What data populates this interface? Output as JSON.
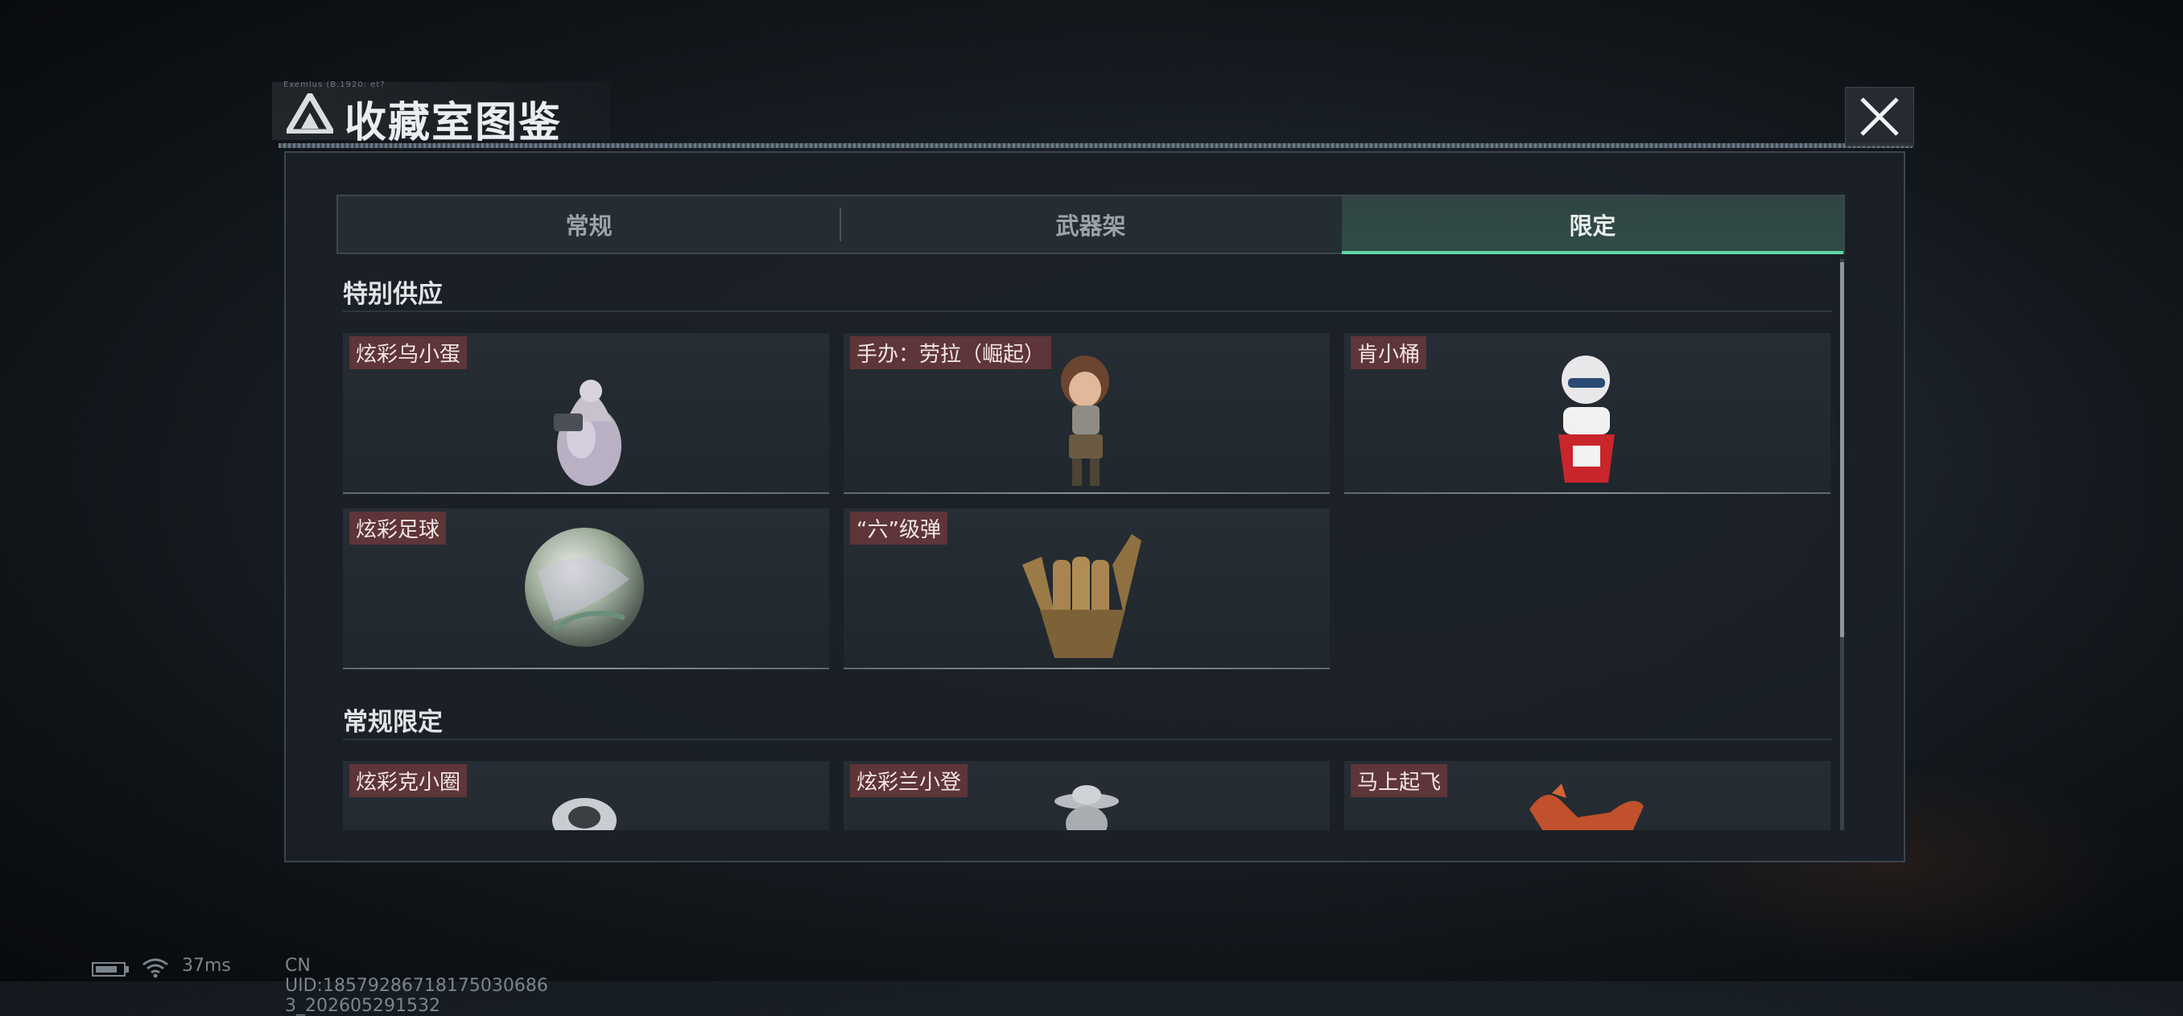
{
  "window": {
    "title": "收藏室图鉴",
    "header_small_text": "Exemlus (B.1920: et?"
  },
  "tabs": [
    {
      "label": "常规",
      "active": false
    },
    {
      "label": "武器架",
      "active": false
    },
    {
      "label": "限定",
      "active": true
    }
  ],
  "sections": [
    {
      "title": "特别供应",
      "items": [
        {
          "label": "炫彩乌小蛋",
          "icon": "egg-figure-icon"
        },
        {
          "label": "手办：劳拉（崛起）",
          "icon": "lara-figure-icon"
        },
        {
          "label": "肯小桶",
          "icon": "colonel-bucket-icon"
        },
        {
          "label": "炫彩足球",
          "icon": "iridescent-ball-icon"
        },
        {
          "label": "“六”级弹",
          "icon": "golden-hand-icon"
        }
      ]
    },
    {
      "title": "常规限定",
      "items": [
        {
          "label": "炫彩克小圈",
          "icon": "silver-ring-icon"
        },
        {
          "label": "炫彩兰小登",
          "icon": "sombrero-figure-icon"
        },
        {
          "label": "马上起飞",
          "icon": "red-horse-icon"
        }
      ]
    }
  ],
  "status_bar": {
    "ping": "37ms",
    "uid": "CN UID:18579286718175030686 3_202605291532"
  },
  "colors": {
    "accent": "#64d6a6",
    "active_tab_bg": "#314b46",
    "label_bg": "#5e3538",
    "panel_bg": "#1b2127"
  }
}
